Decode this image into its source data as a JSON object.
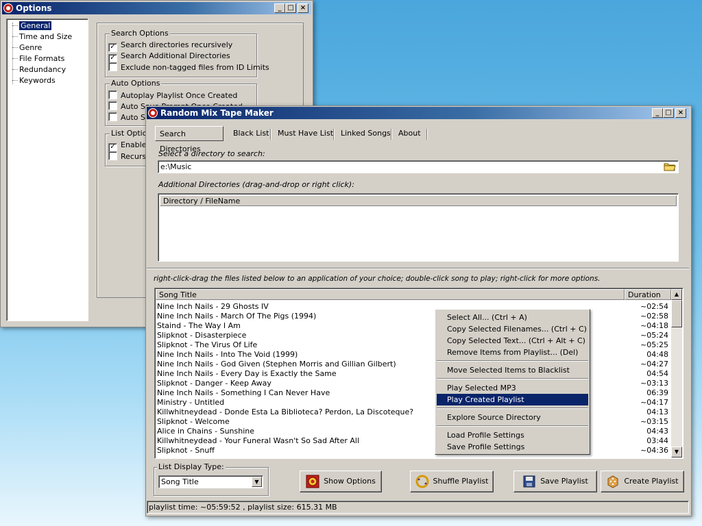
{
  "options_window": {
    "title": "Options",
    "tree": [
      "General",
      "Time and Size",
      "Genre",
      "File Formats",
      "Redundancy",
      "Keywords"
    ],
    "search_options": {
      "label": "Search Options",
      "items": [
        {
          "label": "Search directories recursively",
          "checked": true
        },
        {
          "label": "Search Additional Directories",
          "checked": true
        },
        {
          "label": "Exclude non-tagged files from ID Limits",
          "checked": false
        }
      ]
    },
    "auto_options": {
      "label": "Auto Options",
      "items": [
        {
          "label": "Autoplay Playlist Once Created",
          "checked": false
        },
        {
          "label": "Auto Save Prompt Once Created",
          "checked": false
        },
        {
          "label": "Auto Sa",
          "checked": false
        }
      ]
    },
    "list_options": {
      "label": "List Option",
      "items": [
        {
          "label": "Enable N",
          "checked": true
        },
        {
          "label": "Recursiv",
          "checked": false
        }
      ]
    }
  },
  "main_window": {
    "title": "Random Mix Tape Maker",
    "tabs": [
      "Search Directories",
      "Black List",
      "Must Have List",
      "Linked Songs",
      "About"
    ],
    "select_dir_label": "Select a directory to search:",
    "dir_value": "e:\\Music",
    "additional_label": "Additional Directories (drag-and-drop or right click):",
    "dir_column": "Directory / FileName",
    "hint": "right-click-drag the files listed below to an application of your choice; double-click song to play; right-click for more options.",
    "columns": {
      "title": "Song Title",
      "duration": "Duration"
    },
    "songs": [
      {
        "title": "Nine Inch Nails - 29 Ghosts IV",
        "duration": "~02:54"
      },
      {
        "title": "Nine Inch Nails - March Of The Pigs (1994)",
        "duration": "~02:58"
      },
      {
        "title": "Staind - The Way I Am",
        "duration": "~04:18"
      },
      {
        "title": "Slipknot - Disasterpiece",
        "duration": "~05:24"
      },
      {
        "title": "Slipknot - The Virus Of Life",
        "duration": "~05:25"
      },
      {
        "title": "Nine Inch Nails - Into The Void (1999)",
        "duration": "04:48"
      },
      {
        "title": "Nine Inch Nails - God Given (Stephen Morris and Gillian Gilbert)",
        "duration": "~04:27"
      },
      {
        "title": "Nine Inch Nails - Every Day is Exactly the Same",
        "duration": "04:54"
      },
      {
        "title": "Slipknot - Danger - Keep Away",
        "duration": "~03:13"
      },
      {
        "title": "Nine Inch Nails - Something I Can Never Have",
        "duration": "06:39"
      },
      {
        "title": "Ministry - Untitled",
        "duration": "~04:17"
      },
      {
        "title": "Killwhitneydead - Donde Esta La Biblioteca? Perdon, La Discoteque?",
        "duration": "04:13"
      },
      {
        "title": "Slipknot - Welcome",
        "duration": "~03:15"
      },
      {
        "title": "Alice in Chains - Sunshine",
        "duration": "04:43"
      },
      {
        "title": "Killwhitneydead - Your Funeral Wasn't So Sad After All",
        "duration": "03:44"
      },
      {
        "title": "Slipknot - Snuff",
        "duration": "~04:36"
      }
    ],
    "context_menu": [
      "Select All... (Ctrl + A)",
      "Copy Selected Filenames... (Ctrl + C)",
      "Copy Selected Text... (Ctrl + Alt + C)",
      "Remove Items from Playlist... (Del)",
      "Move Selected Items to Blacklist",
      "Play Selected MP3",
      "Play Created Playlist",
      "Explore Source Directory",
      "Load Profile Settings",
      "Save Profile Settings"
    ],
    "list_display_label": "List Display Type:",
    "list_display_value": "Song Title",
    "buttons": {
      "show_options": "Show Options",
      "shuffle": "Shuffle Playlist",
      "save": "Save Playlist",
      "create": "Create Playlist"
    },
    "status": "playlist time: ~05:59:52 , playlist size: 615.31 MB"
  }
}
